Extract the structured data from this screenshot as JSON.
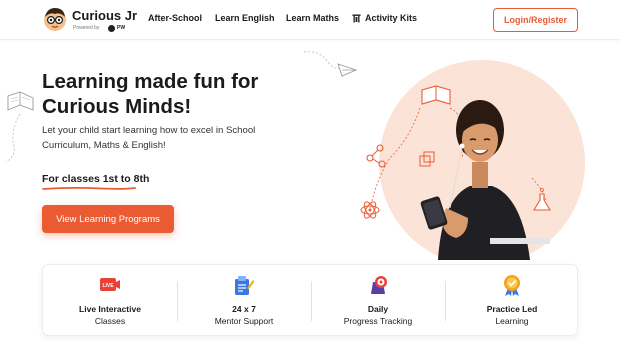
{
  "header": {
    "logo": {
      "title": "Curious Jr",
      "powered_by": "Powered by",
      "brand_mark": "PW"
    },
    "nav": [
      {
        "label": "After-School"
      },
      {
        "label": "Learn English"
      },
      {
        "label": "Learn Maths"
      },
      {
        "label": "Activity Kits",
        "icon": "kits-icon"
      }
    ],
    "login_label": "Login/Register"
  },
  "hero": {
    "title": "Learning made fun for Curious Minds!",
    "subtitle": "Let your child start learning how to excel in School Curriculum, Maths & English!",
    "classes_label": "For classes 1st to 8th",
    "cta_label": "View Learning Programs"
  },
  "features": [
    {
      "icon": "live-icon",
      "title": "Live Interactive",
      "subtitle": "Classes"
    },
    {
      "icon": "mentor-support-icon",
      "title": "24 x 7",
      "subtitle": "Mentor Support"
    },
    {
      "icon": "progress-tracking-icon",
      "title": "Daily",
      "subtitle": "Progress Tracking"
    },
    {
      "icon": "practice-badge-icon",
      "title": "Practice Led",
      "subtitle": "Learning"
    }
  ],
  "colors": {
    "accent": "#ea5b34",
    "peach": "#fbe3d7",
    "text": "#1b1b1b"
  }
}
